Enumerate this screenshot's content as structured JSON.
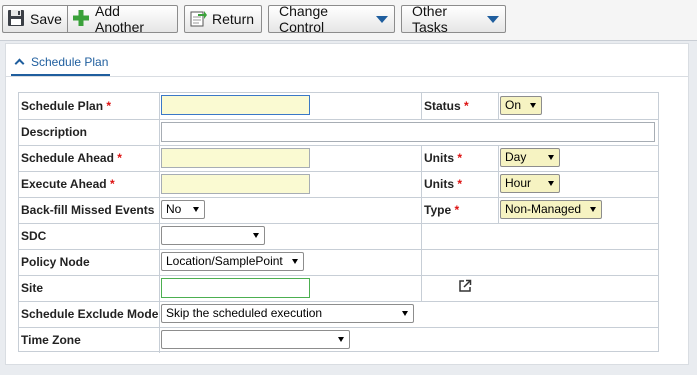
{
  "toolbar": {
    "save_label": "Save",
    "add_another_label": "Add Another",
    "return_label": "Return",
    "change_control_label": "Change Control",
    "other_tasks_label": "Other Tasks"
  },
  "panel": {
    "tab_label": "Schedule Plan"
  },
  "form": {
    "required_marker": "*",
    "schedule_plan": {
      "label": "Schedule Plan",
      "value": ""
    },
    "status": {
      "label": "Status",
      "value": "On"
    },
    "description": {
      "label": "Description",
      "value": ""
    },
    "schedule_ahead": {
      "label": "Schedule Ahead",
      "value": ""
    },
    "units_1": {
      "label": "Units",
      "value": "Day"
    },
    "execute_ahead": {
      "label": "Execute Ahead",
      "value": ""
    },
    "units_2": {
      "label": "Units",
      "value": "Hour"
    },
    "backfill": {
      "label": "Back-fill Missed Events",
      "value": "No"
    },
    "type": {
      "label": "Type",
      "value": "Non-Managed"
    },
    "sdc": {
      "label": "SDC",
      "value": ""
    },
    "policy_node": {
      "label": "Policy Node",
      "value": "Location/SamplePoint"
    },
    "site": {
      "label": "Site",
      "value": ""
    },
    "exclude_mode": {
      "label": "Schedule Exclude Mode",
      "value": "Skip the scheduled execution"
    },
    "time_zone": {
      "label": "Time Zone",
      "value": ""
    }
  },
  "colors": {
    "accent": "#1f5e9e",
    "required": "#d11111",
    "required_field_bg": "#fafad2"
  },
  "icons": [
    "save-icon",
    "add-icon",
    "return-icon",
    "dropdown-icon",
    "chevron-up-icon",
    "external-link-icon"
  ]
}
